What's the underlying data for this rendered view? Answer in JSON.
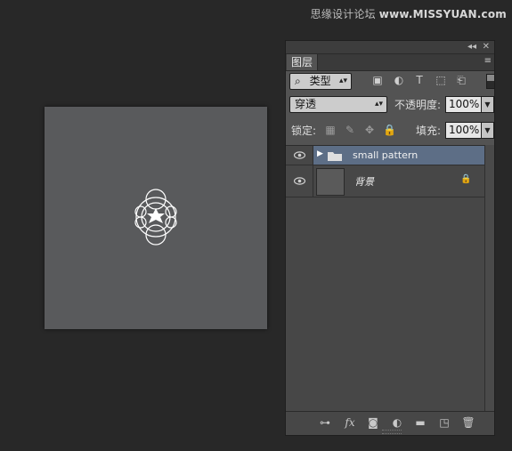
{
  "watermark": {
    "prefix": "思缘设计论坛",
    "site": "www.MISSYUAN.com"
  },
  "panel": {
    "top_icons": {
      "collapse": "◂◂",
      "close": "✕"
    },
    "tab_label": "图层",
    "tab_menu_icon": "≡",
    "filter": {
      "kind_label": "类型",
      "search_glyph": "⌕"
    },
    "blend": {
      "mode": "穿透",
      "opacity_label": "不透明度:",
      "opacity_value": "100%"
    },
    "lock_row": {
      "label": "锁定:",
      "fill_label": "填充:",
      "fill_value": "100%"
    },
    "layers": [
      {
        "name": "small pattern",
        "type": "group",
        "visible": true,
        "selected": true
      },
      {
        "name": "背景",
        "type": "background",
        "visible": true,
        "locked": true
      }
    ],
    "bottom_icons": [
      "link-icon",
      "fx-icon",
      "mask-icon",
      "adjustment-icon",
      "folder-icon",
      "new-layer-icon",
      "trash-icon"
    ],
    "fx_label": "fx"
  },
  "colors": {
    "selected_row": "#5d6e86",
    "canvas": "#595a5c",
    "app_bg": "#282828"
  }
}
